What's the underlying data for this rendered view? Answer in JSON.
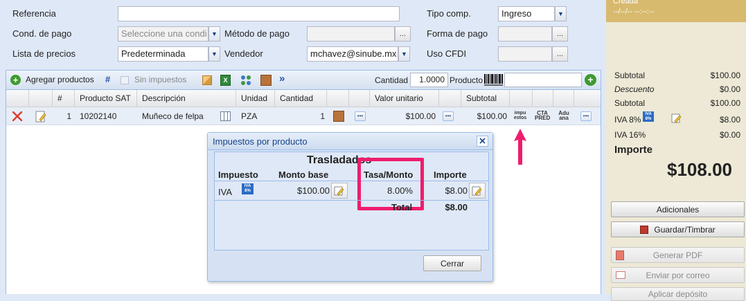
{
  "form": {
    "referencia_label": "Referencia",
    "referencia_value": "",
    "cond_pago_label": "Cond. de pago",
    "cond_pago_placeholder": "Seleccione una condi",
    "metodo_pago_label": "Método de pago",
    "metodo_pago_value": "",
    "lista_precios_label": "Lista de precios",
    "lista_precios_value": "Predeterminada",
    "vendedor_label": "Vendedor",
    "vendedor_value": "mchavez@sinube.mx",
    "tipo_comp_label": "Tipo comp.",
    "tipo_comp_value": "Ingreso",
    "forma_pago_label": "Forma de pago",
    "forma_pago_value": "",
    "uso_cfdi_label": "Uso CFDI",
    "uso_cfdi_value": "",
    "ellipsis": "..."
  },
  "toolbar": {
    "add_products": "Agregar productos",
    "hash": "#",
    "sin_impuestos": "Sin impuestos",
    "chevrons": "»",
    "cantidad_label": "Cantidad",
    "cantidad_value": "1.0000",
    "producto_label": "Producto",
    "producto_value": ""
  },
  "grid": {
    "headers": [
      "#",
      "Producto SAT",
      "Descripción",
      "Unidad",
      "Cantidad",
      "Valor unitario",
      "Subtotal"
    ],
    "rows": [
      {
        "num": "1",
        "producto_sat": "10202140",
        "descripcion": "Muñeco de felpa",
        "unidad": "PZA",
        "cantidad": "1",
        "valor_unitario": "$100.00",
        "subtotal": "$100.00",
        "impuestos_btn": "impu estos",
        "cta_btn": "CTA PRED",
        "aduana_btn": "Adu ana"
      }
    ]
  },
  "modal": {
    "title": "Impuestos por producto",
    "section_title": "Trasladados",
    "col_impuesto": "Impuesto",
    "col_monto_base": "Monto base",
    "col_tasa": "Tasa/Monto",
    "col_importe": "Importe",
    "row_impuesto": "IVA",
    "row_monto_base": "$100.00",
    "row_tasa": "8.00%",
    "row_importe": "$8.00",
    "total_label": "Total",
    "total_value": "$8.00",
    "iva_badge_top": "IVA",
    "iva_badge_bottom": "8%",
    "cerrar": "Cerrar"
  },
  "summary": {
    "status": "Creada",
    "status_datetime": "--/--/-- --:--:--",
    "subtotal1_label": "Subtotal",
    "subtotal1_value": "$100.00",
    "descuento_label": "Descuento",
    "descuento_value": "$0.00",
    "subtotal2_label": "Subtotal",
    "subtotal2_value": "$100.00",
    "iva8_label": "IVA 8%",
    "iva8_value": "$8.00",
    "iva16_label": "IVA 16%",
    "iva16_value": "$0.00",
    "importe_label": "Importe",
    "importe_value": "$108.00",
    "iva_badge_top": "IVA",
    "iva_badge_bottom": "8%"
  },
  "actions": {
    "adicionales": "Adicionales",
    "guardar_timbrar": "Guardar/Timbrar",
    "generar_pdf": "Generar PDF",
    "enviar_correo": "Enviar por correo",
    "aplicar_deposito": "Aplicar depósito"
  },
  "colors": {
    "highlight": "#ee1d6e",
    "panel_bg": "#dfe8f6",
    "summary_bg": "#ede9d6"
  }
}
